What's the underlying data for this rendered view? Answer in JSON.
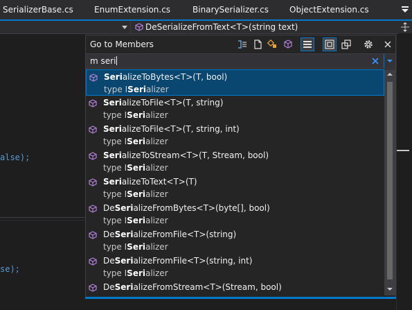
{
  "tabs": [
    "SerializerBase.cs",
    "EnumExtension.cs",
    "BinarySerializer.cs",
    "ObjectExtension.cs"
  ],
  "navbar": {
    "member": "DeSerializeFromText<T>(string text)"
  },
  "editor": {
    "line1": "alse);",
    "line2": "se);"
  },
  "popup": {
    "title": "Go to Members",
    "query": "m seri"
  },
  "results": [
    {
      "name": [
        "Seri",
        "alizeToBytes<T>(T, bool)"
      ],
      "type": [
        "type I",
        "Seri",
        "alizer"
      ]
    },
    {
      "name": [
        "Seri",
        "alizeToFile<T>(T, string)"
      ],
      "type": [
        "type I",
        "Seri",
        "alizer"
      ]
    },
    {
      "name": [
        "Seri",
        "alizeToFile<T>(T, string, int)"
      ],
      "type": [
        "type I",
        "Seri",
        "alizer"
      ]
    },
    {
      "name": [
        "Seri",
        "alizeToStream<T>(T, Stream, bool)"
      ],
      "type": [
        "type I",
        "Seri",
        "alizer"
      ]
    },
    {
      "name": [
        "Seri",
        "alizeToText<T>(T)"
      ],
      "type": [
        "type I",
        "Seri",
        "alizer"
      ]
    },
    {
      "name": [
        "De",
        "Seri",
        "alizeFromBytes<T>(byte[], bool)"
      ],
      "type": [
        "type I",
        "Seri",
        "alizer"
      ]
    },
    {
      "name": [
        "De",
        "Seri",
        "alizeFromFile<T>(string)"
      ],
      "type": [
        "type I",
        "Seri",
        "alizer"
      ]
    },
    {
      "name": [
        "De",
        "Seri",
        "alizeFromFile<T>(string, int)"
      ],
      "type": [
        "type I",
        "Seri",
        "alizer"
      ]
    },
    {
      "name": [
        "De",
        "Seri",
        "alizeFromStream<T>(Stream, bool)"
      ],
      "type": [
        "type I",
        "Seri",
        "alizer"
      ]
    }
  ],
  "icons": {
    "method": "method-cube-icon",
    "toolbar": [
      "scope-icon",
      "file-icon",
      "types-icon",
      "members-icon",
      "list-view-icon",
      "current-doc-icon",
      "external-items-icon",
      "gear-icon",
      "close-icon"
    ]
  },
  "colors": {
    "accent": "#007acc",
    "selection": "#094771",
    "method_icon": "#b180d7"
  }
}
